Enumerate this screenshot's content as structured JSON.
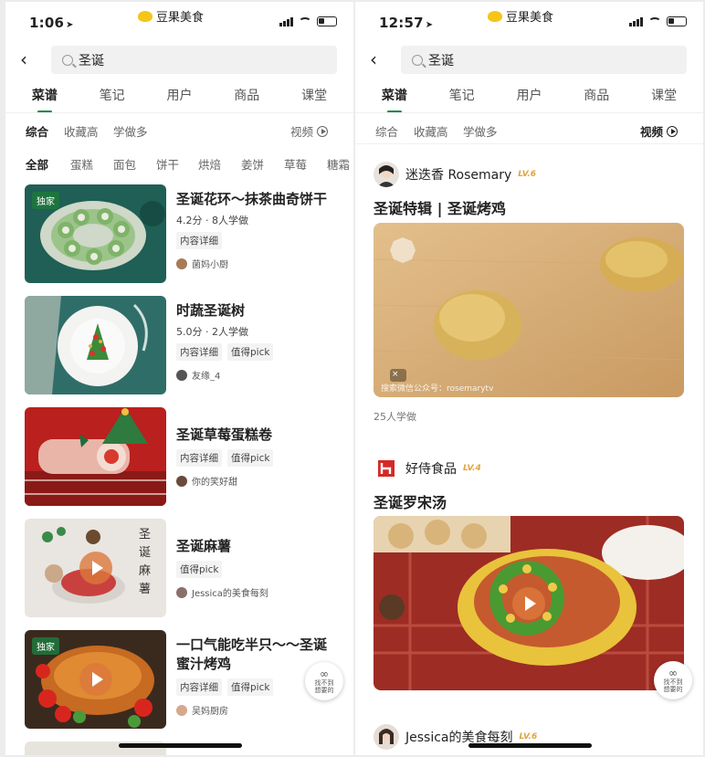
{
  "left": {
    "status": {
      "time": "1:06",
      "app_name": "豆果美食"
    },
    "search": {
      "query": "圣诞"
    },
    "tabs": [
      "菜谱",
      "笔记",
      "用户",
      "商品",
      "课堂"
    ],
    "sorts": [
      "综合",
      "收藏高",
      "学做多"
    ],
    "video_label": "视频",
    "categories": [
      "全部",
      "蛋糕",
      "面包",
      "饼干",
      "烘焙",
      "姜饼",
      "草莓",
      "糖霜"
    ],
    "recipes": [
      {
        "title": "圣诞花环～抹茶曲奇饼干",
        "meta": "4.2分 · 8人学做",
        "tags": [
          "内容详细"
        ],
        "author": "菌妈小厨",
        "badge": "独家"
      },
      {
        "title": "时蔬圣诞树",
        "meta": "5.0分 · 2人学做",
        "tags": [
          "内容详细",
          "值得pick"
        ],
        "author": "友缘_4"
      },
      {
        "title": "圣诞草莓蛋糕卷",
        "tags": [
          "内容详细",
          "值得pick"
        ],
        "author": "你的笑好甜"
      },
      {
        "title": "圣诞麻薯",
        "tags": [
          "值得pick"
        ],
        "author": "Jessica的美食每刻",
        "thumb_text": "圣诞麻薯"
      },
      {
        "title": "一口气能吃半只～～圣诞蜜汁烤鸡",
        "tags": [
          "内容详细",
          "值得pick"
        ],
        "author": "吴妈厨房",
        "badge": "独家"
      }
    ],
    "float_btn": "找不到想要的"
  },
  "right": {
    "status": {
      "time": "12:57",
      "app_name": "豆果美食"
    },
    "search": {
      "query": "圣诞"
    },
    "tabs": [
      "菜谱",
      "笔记",
      "用户",
      "商品",
      "课堂"
    ],
    "sorts": [
      "综合",
      "收藏高",
      "学做多"
    ],
    "video_label": "视频",
    "feed": [
      {
        "author": "迷迭香 Rosemary",
        "level": "LV.6",
        "title": "圣诞特辑 | 圣诞烤鸡",
        "watermark": "搜索微信公众号：rosemarytv",
        "count": "25人学做"
      },
      {
        "author": "好侍食品",
        "level": "LV.4",
        "title": "圣诞罗宋汤"
      },
      {
        "author": "Jessica的美食每刻",
        "level": "LV.6"
      }
    ],
    "float_btn": "找不到想要的"
  },
  "colors": {
    "accent": "#1d8a4a",
    "level": "#e2a33a"
  }
}
